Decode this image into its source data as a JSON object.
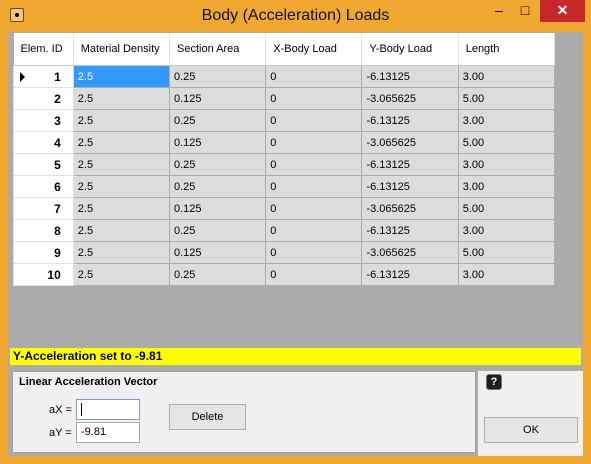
{
  "window": {
    "title": "Body (Acceleration) Loads",
    "minimize": "–",
    "maximize": "□",
    "close": "✕"
  },
  "grid": {
    "headers": [
      "Elem. ID",
      "Material Density",
      "Section Area",
      "X-Body Load",
      "Y-Body Load",
      "Length"
    ],
    "rows": [
      {
        "id": "1",
        "density": "2.5",
        "area": "0.25",
        "xload": "0",
        "yload": "-6.13125",
        "length": "3.00"
      },
      {
        "id": "2",
        "density": "2.5",
        "area": "0.125",
        "xload": "0",
        "yload": "-3.065625",
        "length": "5.00"
      },
      {
        "id": "3",
        "density": "2.5",
        "area": "0.25",
        "xload": "0",
        "yload": "-6.13125",
        "length": "3.00"
      },
      {
        "id": "4",
        "density": "2.5",
        "area": "0.125",
        "xload": "0",
        "yload": "-3.065625",
        "length": "5.00"
      },
      {
        "id": "5",
        "density": "2.5",
        "area": "0.25",
        "xload": "0",
        "yload": "-6.13125",
        "length": "3.00"
      },
      {
        "id": "6",
        "density": "2.5",
        "area": "0.25",
        "xload": "0",
        "yload": "-6.13125",
        "length": "3.00"
      },
      {
        "id": "7",
        "density": "2.5",
        "area": "0.125",
        "xload": "0",
        "yload": "-3.065625",
        "length": "5.00"
      },
      {
        "id": "8",
        "density": "2.5",
        "area": "0.25",
        "xload": "0",
        "yload": "-6.13125",
        "length": "3.00"
      },
      {
        "id": "9",
        "density": "2.5",
        "area": "0.125",
        "xload": "0",
        "yload": "-3.065625",
        "length": "5.00"
      },
      {
        "id": "10",
        "density": "2.5",
        "area": "0.25",
        "xload": "0",
        "yload": "-6.13125",
        "length": "3.00"
      }
    ]
  },
  "status": {
    "message": "Y-Acceleration set to -9.81",
    "color": "#ffff00"
  },
  "accel": {
    "group_title": "Linear Acceleration Vector",
    "ax_label": "aX =",
    "ax_value": "",
    "ay_label": "aY =",
    "ay_value": "-9.81",
    "delete_label": "Delete"
  },
  "footer": {
    "ok_label": "OK",
    "help_icon": "question-mark-icon"
  },
  "colors": {
    "title_bar": "#f0a830",
    "selection": "#3399ff",
    "close_button": "#c7282a"
  }
}
